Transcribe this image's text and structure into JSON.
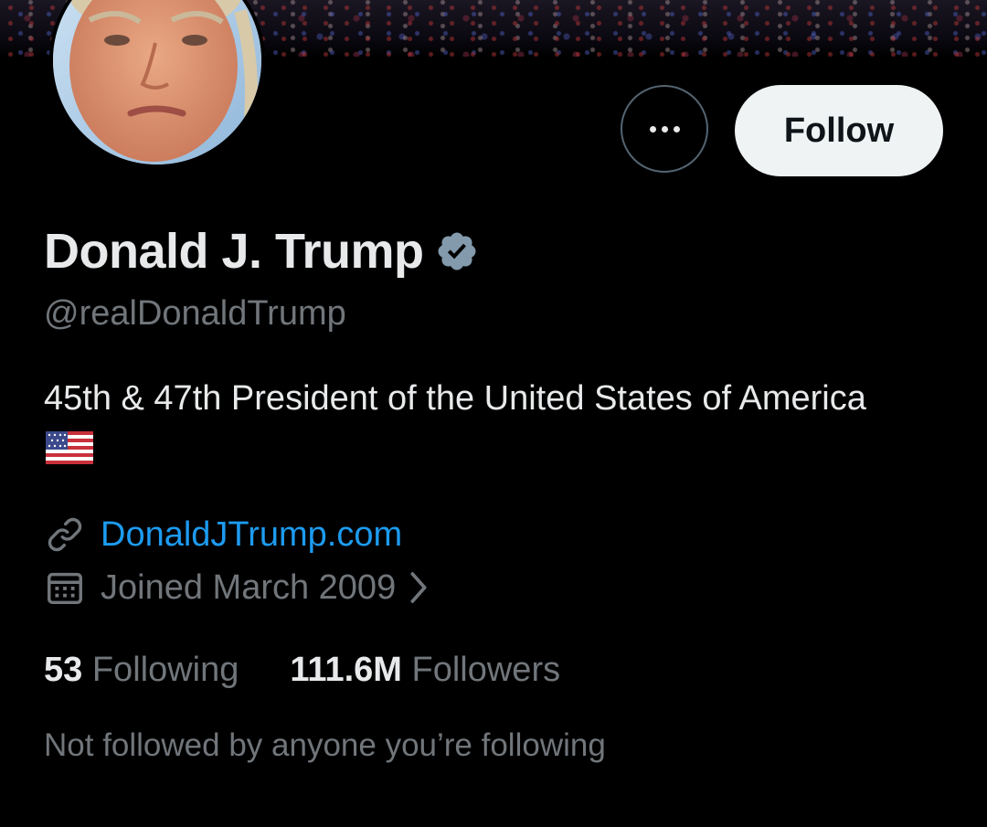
{
  "profile": {
    "display_name": "Donald J. Trump",
    "handle": "@realDonaldTrump",
    "bio": "45th & 47th President of the United States of America",
    "website": "DonaldJTrump.com",
    "joined": "Joined March 2009",
    "verified": true
  },
  "actions": {
    "follow_label": "Follow",
    "more_icon": "more-horizontal-icon"
  },
  "stats": {
    "following_count": "53",
    "following_label": "Following",
    "followers_count": "111.6M",
    "followers_label": "Followers"
  },
  "social_context": "Not followed by anyone you’re following",
  "colors": {
    "background": "#000000",
    "text_primary": "#e7e9ea",
    "text_secondary": "#71767b",
    "link": "#1d9bf0",
    "follow_button_bg": "#eff3f4",
    "verified_badge": "#829aab"
  }
}
